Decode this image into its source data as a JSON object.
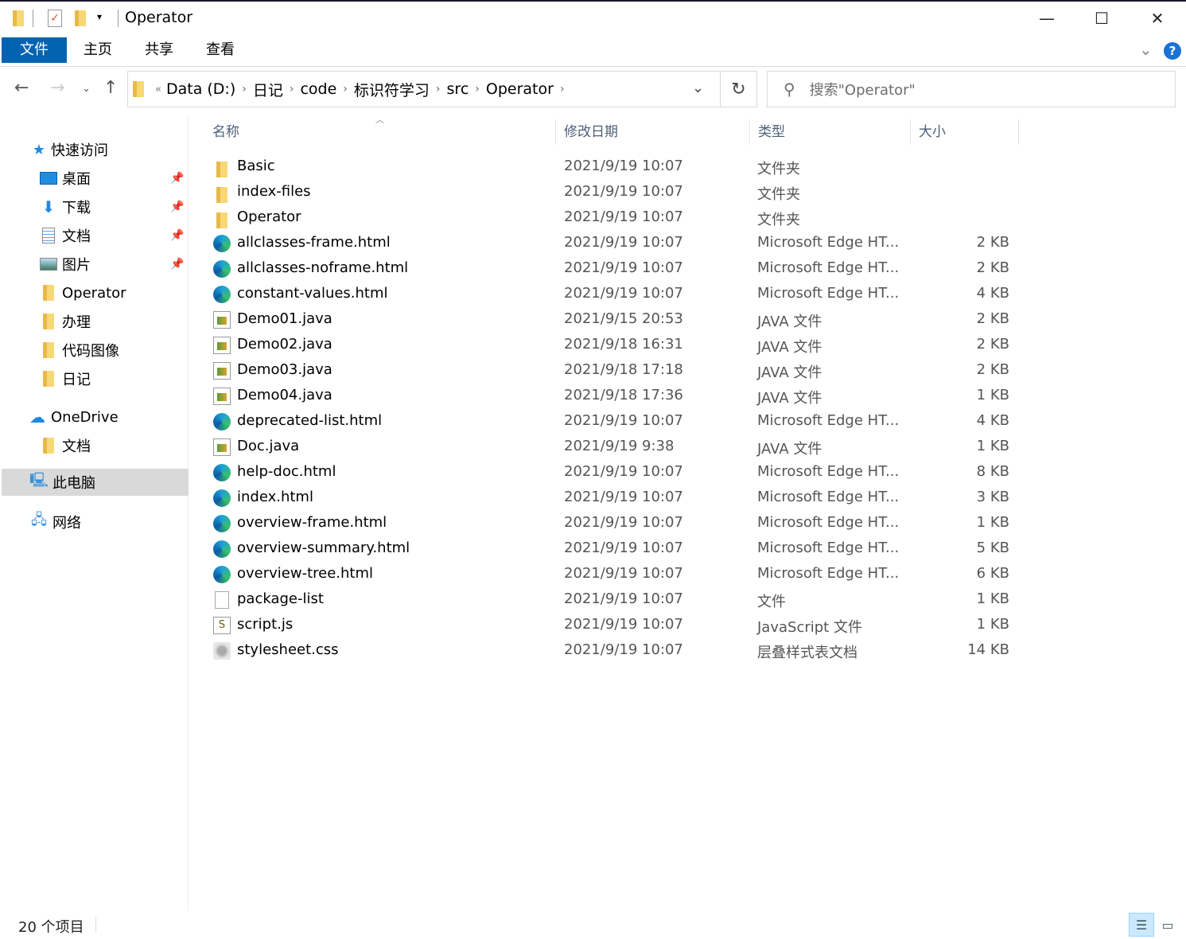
{
  "window": {
    "title": "Operator",
    "minimize": "—",
    "maximize": "☐",
    "close": "✕"
  },
  "ribbon": {
    "tabs": [
      "文件",
      "主页",
      "共享",
      "查看"
    ],
    "help": "?",
    "expand": "⌄"
  },
  "address": {
    "overflow": "«",
    "crumbs": [
      "Data (D:)",
      "日记",
      "code",
      "标识符学习",
      "src",
      "Operator"
    ]
  },
  "search": {
    "placeholder": "搜索\"Operator\""
  },
  "sidebar": {
    "quick_access": "快速访问",
    "items": [
      {
        "label": "桌面",
        "icon": "desktop-icon",
        "pinned": true
      },
      {
        "label": "下载",
        "icon": "download-icon",
        "pinned": true
      },
      {
        "label": "文档",
        "icon": "documents-icon",
        "pinned": true
      },
      {
        "label": "图片",
        "icon": "pictures-icon",
        "pinned": true
      },
      {
        "label": "Operator",
        "icon": "folder-icon"
      },
      {
        "label": "办理",
        "icon": "folder-icon"
      },
      {
        "label": "代码图像",
        "icon": "folder-icon"
      },
      {
        "label": "日记",
        "icon": "folder-icon"
      }
    ],
    "onedrive": "OneDrive",
    "onedrive_items": [
      "文档"
    ],
    "this_pc": "此电脑",
    "network": "网络"
  },
  "columns": {
    "name": "名称",
    "date": "修改日期",
    "type": "类型",
    "size": "大小"
  },
  "files": [
    {
      "name": "Basic",
      "date": "2021/9/19 10:07",
      "type": "文件夹",
      "size": "",
      "icon": "folder"
    },
    {
      "name": "index-files",
      "date": "2021/9/19 10:07",
      "type": "文件夹",
      "size": "",
      "icon": "folder"
    },
    {
      "name": "Operator",
      "date": "2021/9/19 10:07",
      "type": "文件夹",
      "size": "",
      "icon": "folder"
    },
    {
      "name": "allclasses-frame.html",
      "date": "2021/9/19 10:07",
      "type": "Microsoft Edge HT...",
      "size": "2 KB",
      "icon": "edge"
    },
    {
      "name": "allclasses-noframe.html",
      "date": "2021/9/19 10:07",
      "type": "Microsoft Edge HT...",
      "size": "2 KB",
      "icon": "edge"
    },
    {
      "name": "constant-values.html",
      "date": "2021/9/19 10:07",
      "type": "Microsoft Edge HT...",
      "size": "4 KB",
      "icon": "edge"
    },
    {
      "name": "Demo01.java",
      "date": "2021/9/15 20:53",
      "type": "JAVA 文件",
      "size": "2 KB",
      "icon": "java"
    },
    {
      "name": "Demo02.java",
      "date": "2021/9/18 16:31",
      "type": "JAVA 文件",
      "size": "2 KB",
      "icon": "java"
    },
    {
      "name": "Demo03.java",
      "date": "2021/9/18 17:18",
      "type": "JAVA 文件",
      "size": "2 KB",
      "icon": "java"
    },
    {
      "name": "Demo04.java",
      "date": "2021/9/18 17:36",
      "type": "JAVA 文件",
      "size": "1 KB",
      "icon": "java"
    },
    {
      "name": "deprecated-list.html",
      "date": "2021/9/19 10:07",
      "type": "Microsoft Edge HT...",
      "size": "4 KB",
      "icon": "edge"
    },
    {
      "name": "Doc.java",
      "date": "2021/9/19 9:38",
      "type": "JAVA 文件",
      "size": "1 KB",
      "icon": "java"
    },
    {
      "name": "help-doc.html",
      "date": "2021/9/19 10:07",
      "type": "Microsoft Edge HT...",
      "size": "8 KB",
      "icon": "edge"
    },
    {
      "name": "index.html",
      "date": "2021/9/19 10:07",
      "type": "Microsoft Edge HT...",
      "size": "3 KB",
      "icon": "edge"
    },
    {
      "name": "overview-frame.html",
      "date": "2021/9/19 10:07",
      "type": "Microsoft Edge HT...",
      "size": "1 KB",
      "icon": "edge"
    },
    {
      "name": "overview-summary.html",
      "date": "2021/9/19 10:07",
      "type": "Microsoft Edge HT...",
      "size": "5 KB",
      "icon": "edge"
    },
    {
      "name": "overview-tree.html",
      "date": "2021/9/19 10:07",
      "type": "Microsoft Edge HT...",
      "size": "6 KB",
      "icon": "edge"
    },
    {
      "name": "package-list",
      "date": "2021/9/19 10:07",
      "type": "文件",
      "size": "1 KB",
      "icon": "file"
    },
    {
      "name": "script.js",
      "date": "2021/9/19 10:07",
      "type": "JavaScript 文件",
      "size": "1 KB",
      "icon": "js"
    },
    {
      "name": "stylesheet.css",
      "date": "2021/9/19 10:07",
      "type": "层叠样式表文档",
      "size": "14 KB",
      "icon": "css"
    }
  ],
  "status": {
    "count": "20 个项目"
  }
}
